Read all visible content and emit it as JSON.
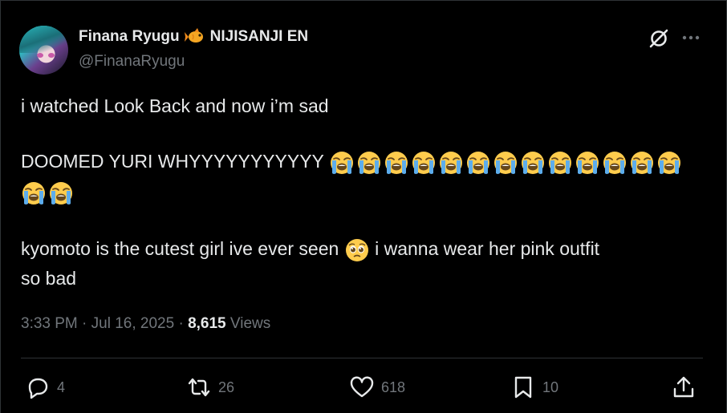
{
  "author": {
    "display_name": "Finana Ryugu",
    "affiliation": "NIJISANJI EN",
    "handle": "@FinanaRyugu",
    "badge_icon": "fish-emoji-icon"
  },
  "post": {
    "line1": "i watched Look Back and now i’m sad",
    "line2_text": "DOOMED YURI WHYYYYYYYYYYY",
    "crying_emoji_count_row1": 13,
    "crying_emoji_count_row2": 2,
    "line3_text_a": "kyomoto is the cutest girl ive ever seen",
    "line3_text_b": "i wanna wear her pink outfit",
    "line4_text": "so bad"
  },
  "meta": {
    "time": "3:33 PM",
    "sep1": "·",
    "date": "Jul 16, 2025",
    "sep2": "·",
    "views_count": "8,615",
    "views_label": "Views"
  },
  "actions": {
    "replies": "4",
    "reposts": "26",
    "likes": "618",
    "bookmarks": "10"
  },
  "colors": {
    "background": "#000000",
    "text": "#e7e9ea",
    "muted": "#71767b",
    "divider": "#2f3336"
  }
}
